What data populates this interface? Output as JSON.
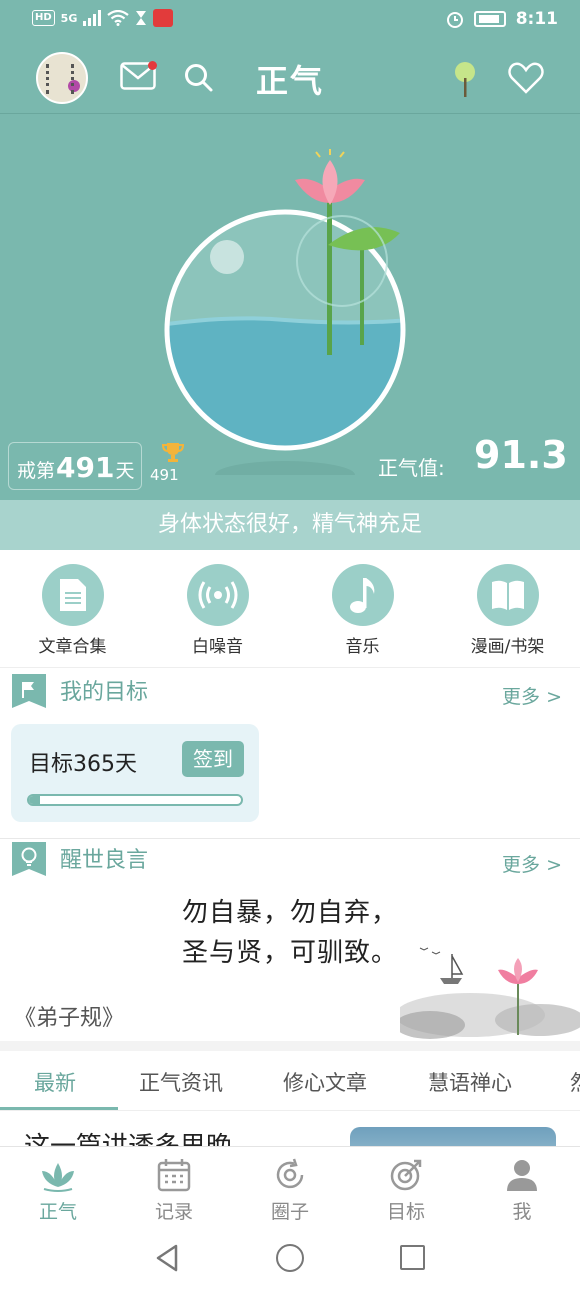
{
  "status_bar": {
    "badge": "HD",
    "network": "5G",
    "time": "8:11"
  },
  "header": {
    "title": "正气"
  },
  "hero": {
    "streak_prefix": "戒第",
    "streak_days": "491",
    "streak_suffix": "天",
    "trophy_count": "491",
    "zhengqi_label": "正气值:",
    "zhengqi_value": "91.3",
    "status_message": "身体状态很好，精气神充足"
  },
  "shortcuts": [
    {
      "label": "文章合集",
      "icon": "document-icon"
    },
    {
      "label": "白噪音",
      "icon": "broadcast-icon"
    },
    {
      "label": "音乐",
      "icon": "music-note-icon"
    },
    {
      "label": "漫画/书架",
      "icon": "book-icon"
    }
  ],
  "goals": {
    "title": "我的目标",
    "more": "更多 >",
    "card_text": "目标365天",
    "checkin_label": "签到",
    "progress": 0.05
  },
  "quotes": {
    "title": "醒世良言",
    "more": "更多 >",
    "line1": "勿自暴，勿自弃，",
    "line2": "圣与贤，可驯致。",
    "source": "《弟子规》"
  },
  "tabs": [
    {
      "label": "最新",
      "active": true
    },
    {
      "label": "正气资讯",
      "active": false
    },
    {
      "label": "修心文章",
      "active": false
    },
    {
      "label": "慧语禅心",
      "active": false
    },
    {
      "label": "然",
      "active": false
    }
  ],
  "article_peek": {
    "title": "这一篇讲透多思晚"
  },
  "bottom_nav": [
    {
      "label": "正气",
      "icon": "lotus-icon",
      "active": true
    },
    {
      "label": "记录",
      "icon": "calendar-icon",
      "active": false
    },
    {
      "label": "圈子",
      "icon": "circle-refresh-icon",
      "active": false
    },
    {
      "label": "目标",
      "icon": "target-icon",
      "active": false
    },
    {
      "label": "我",
      "icon": "person-icon",
      "active": false
    }
  ],
  "colors": {
    "primary": "#7ab8ae",
    "primary_dark": "#6aa79d",
    "strip": "#a8d3cd",
    "notification": "#e4393c"
  }
}
